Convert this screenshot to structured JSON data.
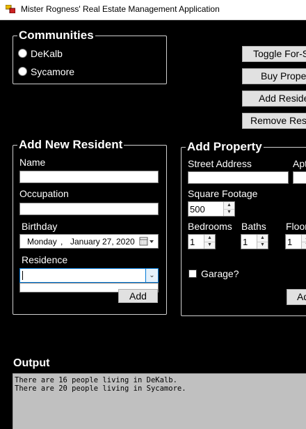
{
  "window": {
    "title": "Mister Rogness' Real Estate Management Application",
    "icon": "app-window-icon"
  },
  "communities": {
    "heading": "Communities",
    "options": [
      {
        "label": "DeKalb",
        "selected": false
      },
      {
        "label": "Sycamore",
        "selected": false
      }
    ]
  },
  "actions": {
    "toggle_for_sale": "Toggle For-Sale",
    "buy_property": "Buy Property",
    "add_resident": "Add Resident",
    "remove_resident": "Remove Resident"
  },
  "add_resident_form": {
    "heading": "Add New Resident",
    "name_label": "Name",
    "name_value": "",
    "occupation_label": "Occupation",
    "occupation_value": "",
    "birthday_label": "Birthday",
    "birthday": {
      "weekday": "Monday",
      "sep": ",",
      "month": "January",
      "day": "27,",
      "year": "2020"
    },
    "residence_label": "Residence",
    "residence_value": "",
    "add_button": "Add"
  },
  "add_property_form": {
    "heading": "Add Property",
    "street_address_label": "Street Address",
    "street_address_value": "",
    "apt_label": "Apt",
    "square_footage_label": "Square Footage",
    "square_footage_value": "500",
    "bedrooms_label": "Bedrooms",
    "bedrooms_value": "1",
    "baths_label": "Baths",
    "baths_value": "1",
    "floors_label": "Floors",
    "floors_value": "1",
    "garage_label": "Garage?",
    "garage_checked": false,
    "add_button": "Add"
  },
  "output": {
    "heading": "Output",
    "text": "There are 16 people living in DeKalb.\nThere are 20 people living in Sycamore."
  }
}
